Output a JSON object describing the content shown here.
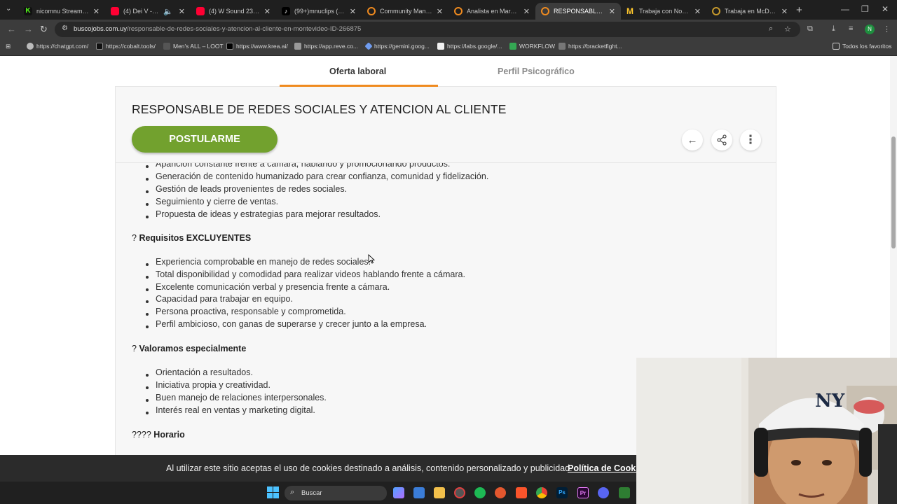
{
  "browser": {
    "tabs": [
      {
        "label": "nicomnu Stream - W",
        "color": "#53fc18"
      },
      {
        "label": "(4) Dei V - VNKLR",
        "color": "#ff0033"
      },
      {
        "label": "(4) W Sound 23 \"5 Es",
        "color": "#ff0033"
      },
      {
        "label": "(99+)mnuclips (@mn",
        "color": "#ffffff"
      },
      {
        "label": "Community Manager",
        "color": "#ef8a1f"
      },
      {
        "label": "Analista en Marketing",
        "color": "#ef8a1f"
      },
      {
        "label": "RESPONSABLE DE RE",
        "color": "#ef8a1f"
      },
      {
        "label": "Trabaja con Nosotros",
        "color": "#ffc72c"
      },
      {
        "label": "Trabaja en McDonald",
        "color": "#c79a2c"
      }
    ],
    "url_domain": "buscojobs.com.uy",
    "url_path": "/responsable-de-redes-sociales-y-atencion-al-cliente-en-montevideo-ID-266875",
    "profile_initial": "N",
    "bookmarks": [
      "https://chatgpt.com/",
      "https://cobalt.tools/",
      "Men's ALL – LOOT",
      "https://www.krea.ai/",
      "https://app.reve.co...",
      "https://gemini.goog...",
      "https://labs.google/...",
      "WORKFLOW",
      "https://bracketfight..."
    ],
    "all_bookmarks": "Todos los favoritos"
  },
  "page": {
    "tabs": {
      "offer": "Oferta laboral",
      "profile": "Perfil Psicográfico"
    },
    "job_title": "RESPONSABLE DE REDES SOCIALES Y ATENCION AL CLIENTE",
    "apply_label": "POSTULARME",
    "tasks": [
      "Aparición constante frente a cámara, hablando y promocionando productos.",
      "Generación de contenido humanizado para crear confianza, comunidad y fidelización.",
      "Gestión de leads provenientes de redes sociales.",
      "Seguimiento y cierre de ventas.",
      "Propuesta de ideas y estrategias para mejorar resultados."
    ],
    "requirements": {
      "prefix": "?",
      "title": "Requisitos EXCLUYENTES",
      "items": [
        "Experiencia comprobable en manejo de redes sociales.",
        "Total disponibilidad y comodidad para realizar videos hablando frente a cámara.",
        "Excelente comunicación verbal y presencia frente a cámara.",
        "Capacidad para trabajar en equipo.",
        "Persona proactiva, responsable y comprometida.",
        "Perfil ambicioso, con ganas de superarse y crecer junto a la empresa."
      ]
    },
    "valued": {
      "prefix": "?",
      "title": "Valoramos especialmente",
      "items": [
        "Orientación a resultados.",
        "Iniciativa propia y creatividad.",
        "Buen manejo de relaciones interpersonales.",
        "Interés real en ventas y marketing digital."
      ]
    },
    "schedule": {
      "prefix": "????",
      "title": "Horario"
    },
    "accent_color": "#ef8a1f",
    "apply_color": "#72a12e"
  },
  "cookie": {
    "text": "Al utilizar este sitio aceptas el uso de cookies destinado a análisis, contenido personalizado y publicidad.",
    "link": "Política de Cookies"
  },
  "taskbar": {
    "search_placeholder": "Buscar"
  }
}
